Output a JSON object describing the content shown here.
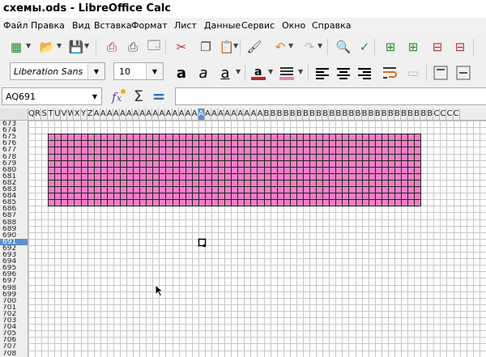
{
  "window": {
    "title": "схемы.ods - LibreOffice Calc"
  },
  "menu": [
    "Файл",
    "Правка",
    "Вид",
    "Вставка",
    "Формат",
    "Лист",
    "Данные",
    "Сервис",
    "Окно",
    "Справка"
  ],
  "toolbar1": [
    {
      "icon": "new-spreadsheet-icon"
    },
    {
      "icon": "open-folder-icon"
    },
    {
      "icon": "save-icon"
    },
    {
      "icon": "export-pdf-icon"
    },
    {
      "icon": "print-icon"
    },
    {
      "icon": "print-preview-icon"
    },
    {
      "icon": "cut-icon"
    },
    {
      "icon": "copy-icon"
    },
    {
      "icon": "paste-icon"
    },
    {
      "icon": "clone-formatting-icon"
    },
    {
      "icon": "undo-icon"
    },
    {
      "icon": "redo-icon"
    },
    {
      "icon": "find-replace-icon"
    },
    {
      "icon": "spelling-icon"
    },
    {
      "icon": "insert-rows-icon"
    },
    {
      "icon": "insert-columns-icon"
    },
    {
      "icon": "delete-rows-icon"
    },
    {
      "icon": "delete-columns-icon"
    }
  ],
  "format_bar": {
    "font_name": "Liberation Sans",
    "font_size": "10",
    "font_color": "#c0282d",
    "highlight_color": "#f080c0"
  },
  "formula_bar": {
    "name_box": "AQ691",
    "input": "",
    "sum_symbol": "Σ",
    "equals_symbol": "="
  },
  "columns": {
    "visible_letters": [
      "Q",
      "R",
      "S",
      "T",
      "U",
      "V",
      "W",
      "X",
      "Y",
      "Z",
      "AA",
      "AB",
      "AC",
      "AD",
      "AE",
      "AF",
      "AG",
      "AH",
      "AI",
      "AJ",
      "AK",
      "AL",
      "AM",
      "AN",
      "AO",
      "AP",
      "AQ",
      "AR",
      "AS",
      "AT",
      "AU",
      "AV",
      "AW",
      "AX",
      "AY",
      "AZ",
      "BA",
      "BB",
      "BC",
      "BD",
      "BE",
      "BF",
      "BG",
      "BH",
      "BI",
      "BJ",
      "BK",
      "BL",
      "BM",
      "BN",
      "BO",
      "BP",
      "BQ",
      "BR",
      "BS",
      "BT",
      "BU",
      "BV",
      "BW",
      "BX",
      "BY",
      "BZ",
      "CA",
      "CB",
      "CC",
      "CD"
    ],
    "selected": "AQ"
  },
  "rows": {
    "first": 673,
    "last": 708,
    "selected": 691
  },
  "fill": {
    "color": "#f080c8",
    "first_row": 675,
    "last_row": 685,
    "first_col": "T",
    "last_col": "BX"
  },
  "colors": {
    "accent": "#5a8fd0",
    "grid": "#c8c8c8"
  }
}
